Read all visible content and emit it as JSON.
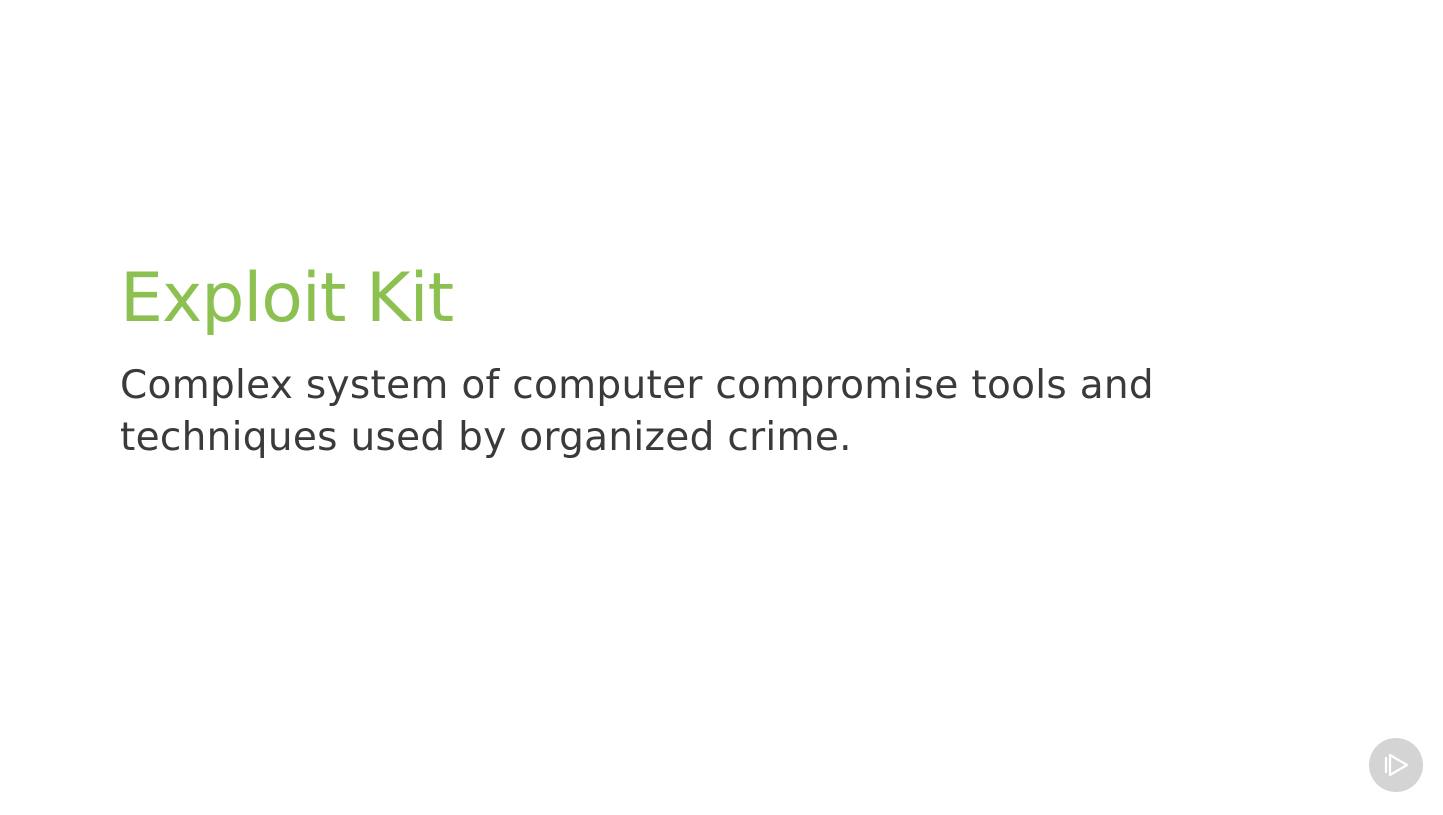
{
  "slide": {
    "title": "Exploit Kit",
    "body": "Complex system of computer compromise tools and techniques used by organized crime."
  },
  "play_badge": {
    "icon": "play-icon"
  },
  "colors": {
    "background": "#ffffff",
    "title": "#8cc152",
    "body": "#3a3a3a",
    "badge_bg": "#d4d4d4",
    "badge_icon": "#ffffff"
  }
}
